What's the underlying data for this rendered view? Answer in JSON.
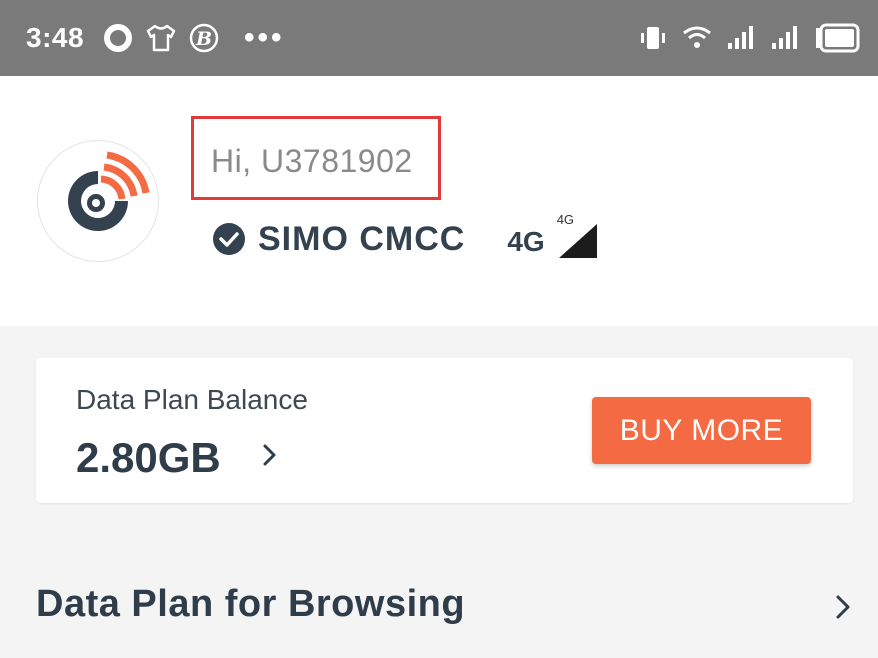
{
  "status_bar": {
    "time": "3:48",
    "left_icons": [
      "circle-icon",
      "shirt-icon",
      "b-badge-icon",
      "more-dots-icon"
    ],
    "more_dots": "•••",
    "right_icons": [
      "vibrate-icon",
      "wifi-icon",
      "signal-icon",
      "signal-icon",
      "battery-icon"
    ]
  },
  "header": {
    "greeting": "Hi, U3781902",
    "operator": "SIMO CMCC",
    "network_type": "4G",
    "signal_label": "4G"
  },
  "balance_card": {
    "label": "Data Plan Balance",
    "value": "2.80GB",
    "buy_button": "BUY MORE"
  },
  "section": {
    "title": "Data Plan for Browsing"
  },
  "colors": {
    "status_bar_bg": "#7a7a7a",
    "accent": "#f46a43",
    "text_dark": "#2f3d4b",
    "highlight_border": "#e03a3a",
    "logo_blue": "#34424f"
  }
}
